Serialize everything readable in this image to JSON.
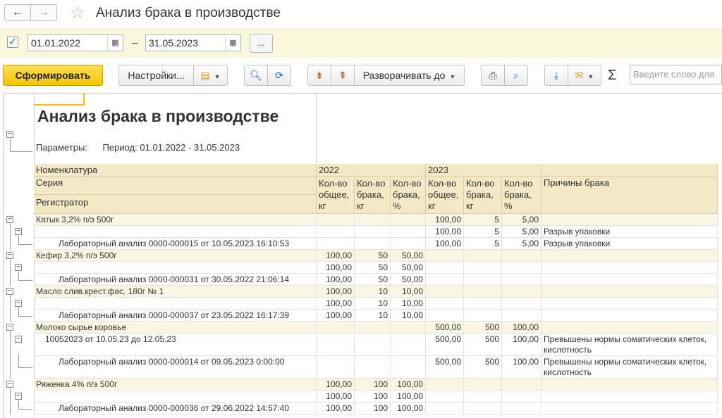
{
  "window": {
    "title": "Анализ брака в производстве"
  },
  "period": {
    "enabled": true,
    "date_from": "01.01.2022",
    "date_to": "31.05.2023",
    "separator": "–",
    "more_label": "..."
  },
  "toolbar": {
    "generate_label": "Сформировать",
    "settings_label": "Настройки...",
    "expand_label": "Разворачивать до",
    "sum_label": "Σ",
    "search_placeholder": "Введите слово для"
  },
  "report": {
    "title": "Анализ брака в производстве",
    "params_label": "Параметры:",
    "params_value": "Период: 01.01.2022 - 31.05.2023",
    "headers": {
      "nomenclature": "Номенклатура",
      "series": "Серия",
      "registrar": "Регистратор",
      "year1": "2022",
      "year2": "2023",
      "qty_total": "Кол-во общее, кг",
      "qty_defect": "Кол-во брака, кг",
      "qty_pct": "Кол-во брака, %",
      "reasons": "Причины брака"
    },
    "rows": [
      {
        "name": "Катык  3,2%  п/э 500г",
        "a": "",
        "b": "",
        "c": "",
        "d": "100,00",
        "e": "5",
        "f": "5,00",
        "r": ""
      },
      {
        "name": "",
        "a": "",
        "b": "",
        "c": "",
        "d": "100,00",
        "e": "5",
        "f": "5,00",
        "r": "Разрыв упаковки"
      },
      {
        "name": "Лабораторный анализ 0000-000015 от 10.05.2023 16:10:53",
        "a": "",
        "b": "",
        "c": "",
        "d": "100,00",
        "e": "5",
        "f": "5,00",
        "r": "Разрыв упаковки"
      },
      {
        "name": "Кефир 3,2%  п/э 500г",
        "a": "100,00",
        "b": "50",
        "c": "50,00",
        "d": "",
        "e": "",
        "f": "",
        "r": ""
      },
      {
        "name": "",
        "a": "100,00",
        "b": "50",
        "c": "50,00",
        "d": "",
        "e": "",
        "f": "",
        "r": ""
      },
      {
        "name": "Лабораторный анализ 0000-000031 от 30.05.2022 21:06:14",
        "a": "100,00",
        "b": "50",
        "c": "50,00",
        "d": "",
        "e": "",
        "f": "",
        "r": ""
      },
      {
        "name": "Масло слив.крест.фас. 180г № 1",
        "a": "100,00",
        "b": "10",
        "c": "10,00",
        "d": "",
        "e": "",
        "f": "",
        "r": ""
      },
      {
        "name": "",
        "a": "100,00",
        "b": "10",
        "c": "10,00",
        "d": "",
        "e": "",
        "f": "",
        "r": ""
      },
      {
        "name": "Лабораторный анализ 0000-000037 от 23.05.2022 16:17:39",
        "a": "100,00",
        "b": "10",
        "c": "10,00",
        "d": "",
        "e": "",
        "f": "",
        "r": ""
      },
      {
        "name": "Молоко сырье коровье",
        "a": "",
        "b": "",
        "c": "",
        "d": "500,00",
        "e": "500",
        "f": "100,00",
        "r": ""
      },
      {
        "name": "10052023 от 10.05.23 до 12.05.23",
        "a": "",
        "b": "",
        "c": "",
        "d": "500,00",
        "e": "500",
        "f": "100,00",
        "r": "Превышены нормы соматических клеток, кислотность"
      },
      {
        "name": "Лабораторный анализ 0000-000014 от 09.05.2023 0:00:00",
        "a": "",
        "b": "",
        "c": "",
        "d": "500,00",
        "e": "500",
        "f": "100,00",
        "r": "Превышены нормы соматических клеток, кислотность"
      },
      {
        "name": "Ряженка 4%  п/э 500г",
        "a": "100,00",
        "b": "100",
        "c": "100,00",
        "d": "",
        "e": "",
        "f": "",
        "r": ""
      },
      {
        "name": "",
        "a": "100,00",
        "b": "100",
        "c": "100,00",
        "d": "",
        "e": "",
        "f": "",
        "r": ""
      },
      {
        "name": "Лабораторный анализ 0000-000036 от 29.06.2022 14:57:40",
        "a": "100,00",
        "b": "100",
        "c": "100,00",
        "d": "",
        "e": "",
        "f": "",
        "r": ""
      }
    ]
  }
}
